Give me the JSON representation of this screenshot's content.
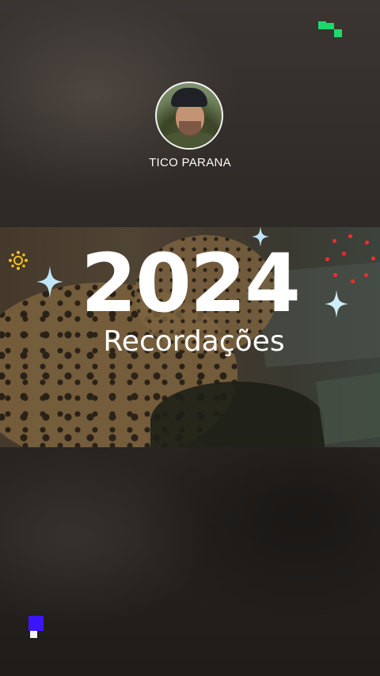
{
  "channel": {
    "name": "TICO PARANA",
    "avatar_icon": "profile-photo"
  },
  "banner": {
    "year": "2024",
    "subtitle": "Recordações"
  },
  "branding": {
    "top_logo_icon": "brand-logo-green",
    "bottom_logo_icon": "brand-logo-blue",
    "accent_green": "#1ed86a",
    "accent_blue": "#3c15ff",
    "sparkle_yellow": "#f4c21a",
    "dots_red": "#ff2a2a"
  }
}
